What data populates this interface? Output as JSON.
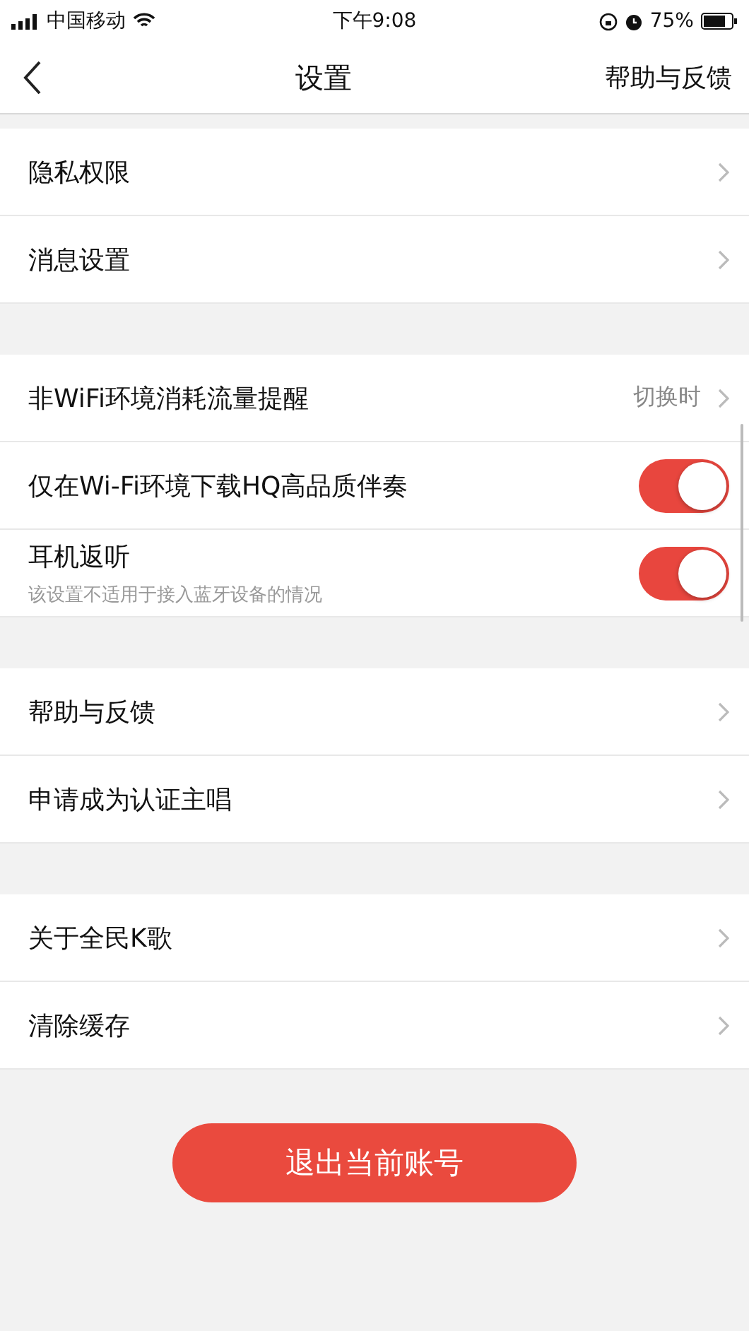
{
  "status_bar": {
    "carrier": "中国移动",
    "time": "下午9:08",
    "battery": "75%"
  },
  "nav": {
    "title": "设置",
    "action": "帮助与反馈"
  },
  "sections": [
    {
      "rows": [
        {
          "kind": "link",
          "label": "隐私权限"
        },
        {
          "kind": "link",
          "label": "消息设置"
        }
      ]
    },
    {
      "rows": [
        {
          "kind": "link",
          "label": "非WiFi环境消耗流量提醒",
          "value": "切换时"
        },
        {
          "kind": "toggle",
          "label": "仅在Wi-Fi环境下载HQ高品质伴奏",
          "on": true
        },
        {
          "kind": "toggle",
          "label": "耳机返听",
          "hint": "该设置不适用于接入蓝牙设备的情况",
          "on": true
        }
      ]
    },
    {
      "rows": [
        {
          "kind": "link",
          "label": "帮助与反馈"
        },
        {
          "kind": "link",
          "label": "申请成为认证主唱"
        }
      ]
    },
    {
      "rows": [
        {
          "kind": "link",
          "label": "关于全民K歌"
        },
        {
          "kind": "link",
          "label": "清除缓存"
        }
      ]
    }
  ],
  "logout_button": "退出当前账号"
}
